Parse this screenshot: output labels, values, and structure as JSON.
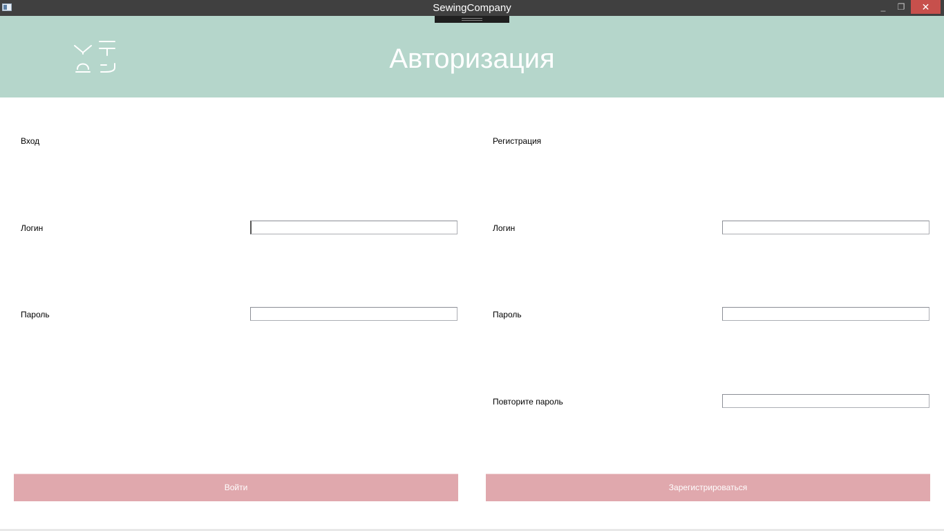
{
  "window": {
    "title": "SewingCompany",
    "controls": {
      "minimize": "_",
      "maximize": "❐",
      "close": "✕"
    },
    "close_color": "#c7504c"
  },
  "header": {
    "title": "Авторизация",
    "background": "#b5d6cb",
    "logo_icon": "sewing-company-logo-icon"
  },
  "login": {
    "section_label": "Вход",
    "login_label": "Логин",
    "login_value": "",
    "password_label": "Пароль",
    "password_value": "",
    "submit_label": "Войти"
  },
  "register": {
    "section_label": "Регистрация",
    "login_label": "Логин",
    "login_value": "",
    "password_label": "Пароль",
    "password_value": "",
    "repeat_password_label": "Повторите пароль",
    "repeat_password_value": "",
    "submit_label": "Зарегистрироваться"
  },
  "colors": {
    "button": "#e0a8ad",
    "titlebar": "#404040"
  }
}
